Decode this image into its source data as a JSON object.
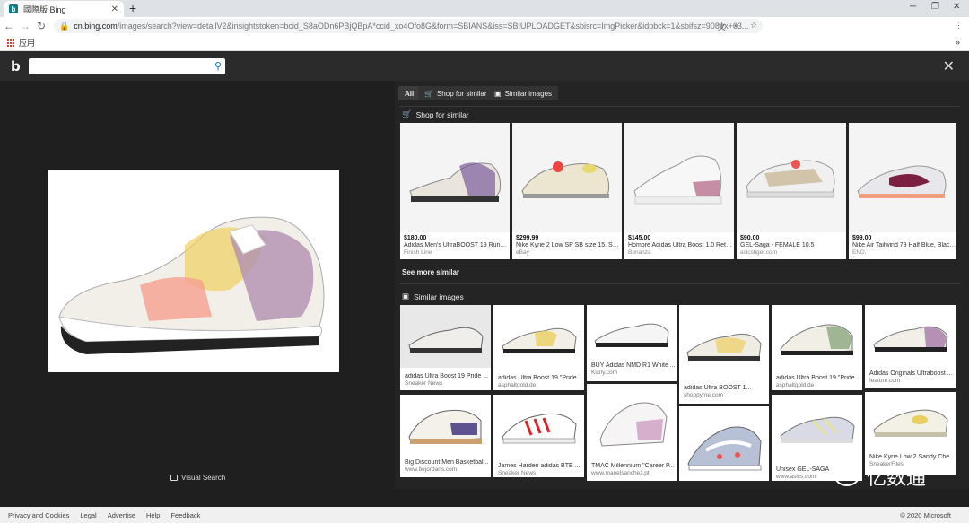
{
  "browser": {
    "tab_title": "國際版 Bing",
    "favicon": "b",
    "url_host": "cn.bing.com",
    "url_path": "/images/search?view=detailV2&insightstoken=bcid_S8aODn6PBjQBpA*ccid_xo4Ofo8G&form=SBIANS&iss=SBIUPLOADGET&sbisrc=ImgPicker&idpbck=1&sbifsz=908+x+63...",
    "bookmark_apps": "应用",
    "chevrons": "»"
  },
  "bing": {
    "logo": "b",
    "search_value": "",
    "tabs": [
      {
        "label": "All",
        "icon": ""
      },
      {
        "label": "Shop for similar",
        "icon": "cart-icon"
      },
      {
        "label": "Similar images",
        "icon": "image-icon"
      }
    ],
    "shop_heading": "Shop for similar",
    "shop_items": [
      {
        "price": "$180.00",
        "name": "Adidas Men's UltraBOOST 19 Running...",
        "shop": "Finish Line"
      },
      {
        "price": "$299.99",
        "name": "Nike Kyrie 2 Low SP SB size 15. Spo...",
        "shop": "eBay"
      },
      {
        "price": "$145.00",
        "name": "Hombre Adidas Ultra Boost 1.0 Retr...",
        "shop": "Bonanza"
      },
      {
        "price": "$90.00",
        "name": "GEL-Saga - FEMALE 10.5",
        "shop": "asicstiger.com"
      },
      {
        "price": "$99.00",
        "name": "Nike Air Tailwind 79 Half Blue, Black ...",
        "shop": "END."
      }
    ],
    "see_more": "See more similar",
    "similar_heading": "Similar images",
    "similar_items": [
      {
        "title": "adidas Ultra Boost 19 Pride ...",
        "source": "Sneaker News"
      },
      {
        "title": "adidas Ultra Boost 19 \"Pride...",
        "source": "asphaltgold.de"
      },
      {
        "title": "BUY Adidas NMD R1 White ...",
        "source": "Kixify.com"
      },
      {
        "title": "adidas Ultra BOOST 1...",
        "source": "shoppyme.com"
      },
      {
        "title": "adidas Ultra Boost 19 \"Pride...",
        "source": "asphaltgold.de"
      },
      {
        "title": "Adidas Originals Ultraboost ...",
        "source": "feature.com"
      },
      {
        "title": "Big Discount Men Basketbal...",
        "source": "www.bejordans.com"
      },
      {
        "title": "James Harden adidas BTE ...",
        "source": "Sneaker News"
      },
      {
        "title": "TMAC Millennium \"Career P...",
        "source": "www.manelsanchez.pt"
      },
      {
        "title": "",
        "source": ""
      },
      {
        "title": "Unisex GEL-SAGA",
        "source": "www.asics.com"
      },
      {
        "title": "Nike Kyrie Low 2 Sandy Che...",
        "source": "SneakerFiles"
      }
    ],
    "visual_search": "Visual Search"
  },
  "footer": {
    "links": [
      "Privacy and Cookies",
      "Legal",
      "Advertise",
      "Help",
      "Feedback"
    ],
    "copyright": "© 2020 Microsoft"
  },
  "watermark": "亿数通"
}
